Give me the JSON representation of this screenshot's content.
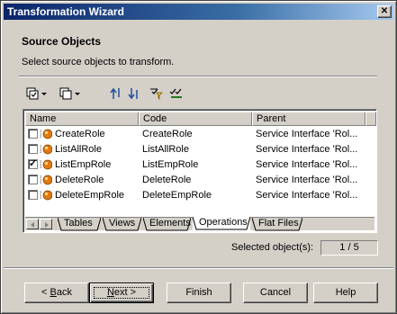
{
  "window": {
    "title": "Transformation Wizard",
    "close_glyph": "✕"
  },
  "page": {
    "title": "Source Objects",
    "description": "Select source objects to transform."
  },
  "toolbar": {
    "icons": [
      "select-all-icon",
      "deselect-icon",
      "move-to-top-icon",
      "move-to-bottom-icon",
      "filter-icon",
      "check-selected-icon"
    ]
  },
  "grid": {
    "columns": [
      "Name",
      "Code",
      "Parent"
    ],
    "rows": [
      {
        "checked": false,
        "name": "CreateRole",
        "code": "CreateRole",
        "parent": "Service Interface 'Rol..."
      },
      {
        "checked": false,
        "name": "ListAllRole",
        "code": "ListAllRole",
        "parent": "Service Interface 'Rol..."
      },
      {
        "checked": true,
        "name": "ListEmpRole",
        "code": "ListEmpRole",
        "parent": "Service Interface 'Rol..."
      },
      {
        "checked": false,
        "name": "DeleteRole",
        "code": "DeleteRole",
        "parent": "Service Interface 'Rol..."
      },
      {
        "checked": false,
        "name": "DeleteEmpRole",
        "code": "DeleteEmpRole",
        "parent": "Service Interface 'Rol..."
      }
    ],
    "check_glyph": "✓"
  },
  "tabs": [
    "Tables",
    "Views",
    "Elements",
    "Operations",
    "Flat Files"
  ],
  "active_tab": "Operations",
  "status": {
    "label": "Selected object(s):",
    "value": "1 / 5"
  },
  "buttons": {
    "back": {
      "mnemonic": "B",
      "rest": "ack",
      "prefix": "< "
    },
    "next": {
      "mnemonic": "N",
      "rest": "ext",
      "suffix": " >"
    },
    "finish": "Finish",
    "cancel": "Cancel",
    "help": "Help"
  },
  "colors": {
    "title_bar": "#0a246a",
    "face": "#d4d0c8",
    "operation_icon": "#e07a10"
  }
}
